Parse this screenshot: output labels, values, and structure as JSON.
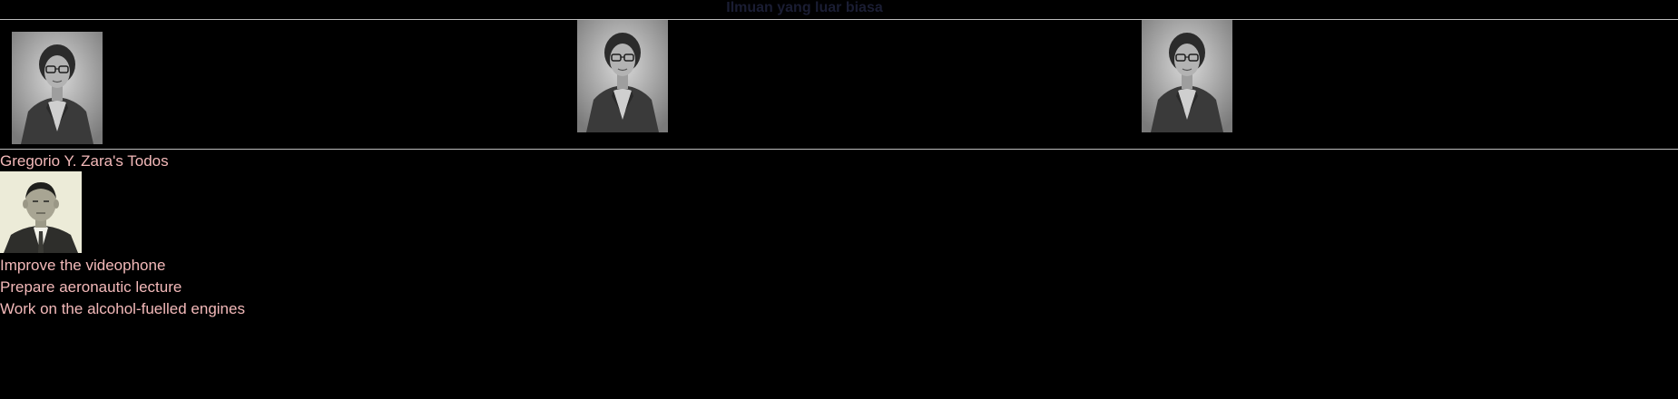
{
  "header": {
    "title": "Ilmuan yang luar biasa"
  },
  "gallery": {
    "photos": [
      {
        "subject": "scientist-portrait"
      },
      {
        "subject": "scientist-portrait"
      },
      {
        "subject": "scientist-portrait"
      }
    ]
  },
  "todos": {
    "heading": "Gregorio Y. Zara's Todos",
    "items": [
      "Improve the videophone",
      "Prepare aeronautic lecture",
      "Work on the alcohol-fuelled engines"
    ]
  },
  "colors": {
    "background": "#000000",
    "text": "#f3b9b9",
    "title": "#1a1d33",
    "divider": "#bdbdbd"
  }
}
